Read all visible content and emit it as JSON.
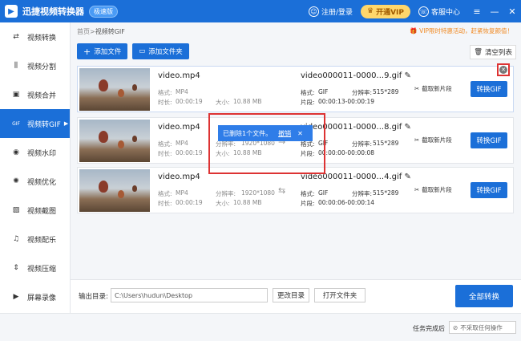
{
  "titlebar": {
    "app_title": "迅捷视频转换器",
    "edition_badge": "极速版",
    "login": "注册/登录",
    "vip": "开通VIP",
    "service": "客服中心"
  },
  "sidebar": {
    "items": [
      {
        "label": "视频转换",
        "icon": "convert-icon"
      },
      {
        "label": "视频分割",
        "icon": "split-icon"
      },
      {
        "label": "视频合并",
        "icon": "merge-icon"
      },
      {
        "label": "视频转GIF",
        "icon": "gif-icon",
        "active": true
      },
      {
        "label": "视频水印",
        "icon": "watermark-icon"
      },
      {
        "label": "视频优化",
        "icon": "optimize-icon"
      },
      {
        "label": "视频截图",
        "icon": "screenshot-icon"
      },
      {
        "label": "视频配乐",
        "icon": "music-icon"
      },
      {
        "label": "视频压缩",
        "icon": "compress-icon"
      },
      {
        "label": "屏幕录像",
        "icon": "record-icon"
      }
    ]
  },
  "breadcrumb": {
    "home": "首页",
    "sep": " > ",
    "current": "视频转GIF"
  },
  "promo": "VIP限时特惠活动，赶紧恢复颜值！",
  "toolbar": {
    "add_file": "添加文件",
    "add_folder": "添加文件夹",
    "clear_list": "清空列表"
  },
  "files": [
    {
      "name": "video.mp4",
      "format_label": "格式:",
      "format": "MP4",
      "res_label": "分辨率:",
      "res": "1920*1080",
      "duration_label": "时长:",
      "duration": "00:00:19",
      "size_label": "大小:",
      "size": "10.88 MB",
      "out_name": "video000011-0000...9.gif",
      "out_format_label": "格式:",
      "out_format": "GIF",
      "out_res_label": "分辨率:",
      "out_res": "515*289",
      "clip_label": "片段:",
      "clip": "00:00:13-00:00:19",
      "cut": "截取新片段",
      "convert": "转换GIF"
    },
    {
      "name": "video.mp4",
      "format_label": "格式:",
      "format": "MP4",
      "res_label": "分辨率:",
      "res": "1920*1080",
      "duration_label": "时长:",
      "duration": "00:00:19",
      "size_label": "大小:",
      "size": "10.88 MB",
      "out_name": "video000011-0000...8.gif",
      "out_format_label": "格式:",
      "out_format": "GIF",
      "out_res_label": "分辨率:",
      "out_res": "515*289",
      "clip_label": "片段:",
      "clip": "00:00:00-00:00:08",
      "cut": "截取新片段",
      "convert": "转换GIF"
    },
    {
      "name": "video.mp4",
      "format_label": "格式:",
      "format": "MP4",
      "res_label": "分辨率:",
      "res": "1920*1080",
      "duration_label": "时长:",
      "duration": "00:00:19",
      "size_label": "大小:",
      "size": "10.88 MB",
      "out_name": "video000011-0000...4.gif",
      "out_format_label": "格式:",
      "out_format": "GIF",
      "out_res_label": "分辨率:",
      "out_res": "515*289",
      "clip_label": "片段:",
      "clip": "00:00:06-00:00:14",
      "cut": "截取新片段",
      "convert": "转换GIF"
    }
  ],
  "toast": {
    "message": "已删除1个文件。",
    "undo": "撤销"
  },
  "bottom": {
    "output_label": "输出目录:",
    "output_path": "C:\\Users\\hudun\\Desktop",
    "change_dir": "更改目录",
    "open_folder": "打开文件夹",
    "convert_all": "全部转换"
  },
  "status": {
    "done_label": "任务完成后",
    "action": "不采取任何操作"
  },
  "colors": {
    "brand": "#1b6fd8",
    "promo": "#f08a24",
    "highlight": "#dd3333"
  }
}
